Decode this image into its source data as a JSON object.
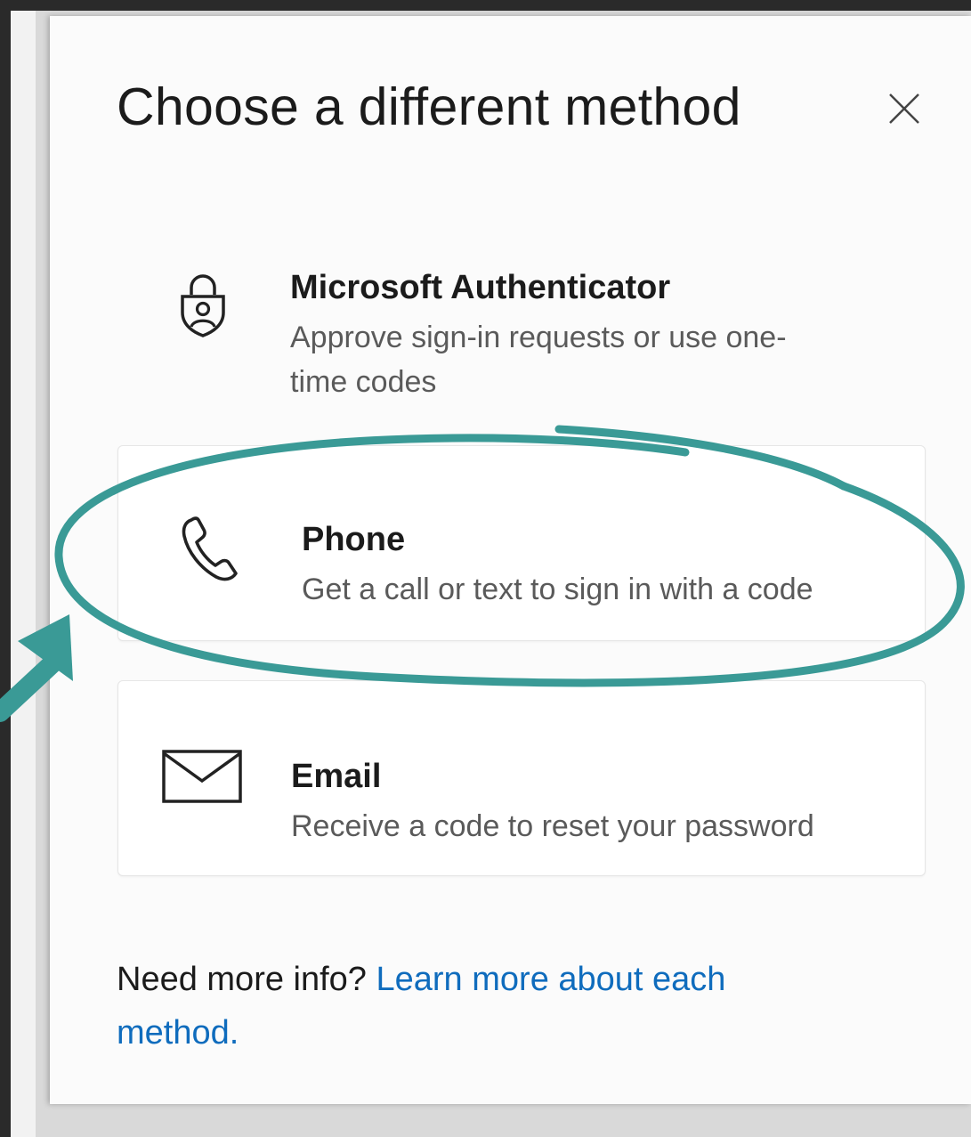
{
  "dialog": {
    "title": "Choose a different method"
  },
  "methods": [
    {
      "title": "Microsoft Authenticator",
      "description_line1": "Approve sign-in requests or use one-",
      "description_line2": "time codes",
      "icon": "authenticator-lock-icon"
    },
    {
      "title": "Phone",
      "description": "Get a call or text to sign in with a code",
      "icon": "phone-icon"
    },
    {
      "title": "Email",
      "description": "Receive a code to reset your password",
      "icon": "envelope-icon"
    }
  ],
  "footer": {
    "prefix": "Need more info?",
    "link_line1": "Learn more about each",
    "link_line2": "method."
  },
  "annotation": {
    "color": "#3a9a96"
  },
  "colors": {
    "link": "#0f6cbd",
    "text": "#1b1b1b",
    "subtext": "#5a5a5a"
  }
}
